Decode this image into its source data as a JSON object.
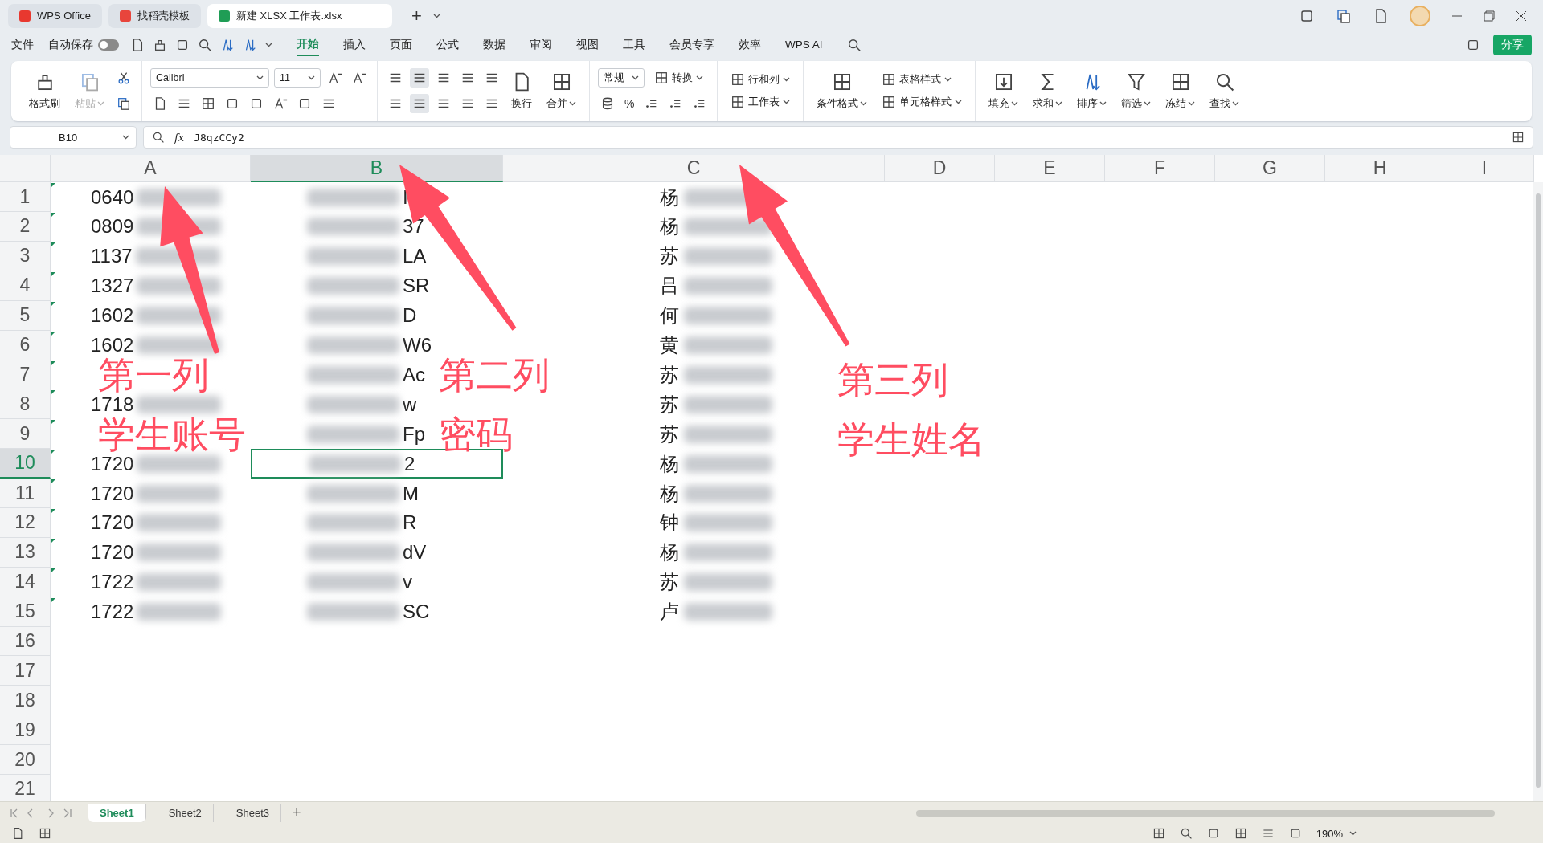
{
  "title_bar": {
    "tabs": [
      {
        "label": "WPS Office",
        "selected": false,
        "color": "#e8382f"
      },
      {
        "label": "找稻壳模板",
        "selected": false,
        "color": "#e8453c"
      },
      {
        "label": "新建 XLSX 工作表.xlsx",
        "selected": true,
        "color": "#1f9d55"
      }
    ],
    "new_tab": "+"
  },
  "menu_bar": {
    "file": "文件",
    "autosave": {
      "label": "自动保存",
      "on": false
    },
    "tabs": [
      {
        "label": "开始",
        "selected": true
      },
      {
        "label": "插入",
        "selected": false
      },
      {
        "label": "页面",
        "selected": false
      },
      {
        "label": "公式",
        "selected": false
      },
      {
        "label": "数据",
        "selected": false
      },
      {
        "label": "审阅",
        "selected": false
      },
      {
        "label": "视图",
        "selected": false
      },
      {
        "label": "工具",
        "selected": false
      },
      {
        "label": "会员专享",
        "selected": false
      },
      {
        "label": "效率",
        "selected": false
      },
      {
        "label": "WPS AI",
        "selected": false
      }
    ],
    "share": "分享"
  },
  "ribbon": {
    "groups": [
      {
        "items": [
          {
            "kind": "large",
            "label": "格式刷",
            "menu": false,
            "disabled": false
          },
          {
            "kind": "large",
            "label": "粘贴",
            "menu": true,
            "disabled": true
          },
          {
            "kind": "stack",
            "rows": [
              [
                {
                  "kind": "icon",
                  "selected": false
                }
              ],
              [
                {
                  "kind": "icon",
                  "selected": false
                }
              ]
            ]
          }
        ]
      },
      {
        "items": [
          {
            "kind": "stack",
            "rows": [
              [
                {
                  "kind": "select",
                  "value": "Calibri",
                  "wide": true
                },
                {
                  "kind": "select",
                  "value": "11",
                  "wide": false
                },
                {
                  "kind": "icon",
                  "selected": false
                },
                {
                  "kind": "icon",
                  "selected": false
                }
              ],
              [
                {
                  "kind": "icon",
                  "selected": false
                },
                {
                  "kind": "icon",
                  "selected": false
                },
                {
                  "kind": "icon",
                  "selected": false
                },
                {
                  "kind": "icon",
                  "selected": false
                },
                {
                  "kind": "icon",
                  "selected": false
                },
                {
                  "kind": "icon",
                  "selected": false
                },
                {
                  "kind": "icon",
                  "selected": false
                },
                {
                  "kind": "icon",
                  "selected": false
                }
              ]
            ]
          }
        ]
      },
      {
        "items": [
          {
            "kind": "stack",
            "rows": [
              [
                {
                  "kind": "icon",
                  "selected": false
                },
                {
                  "kind": "icon",
                  "selected": true
                },
                {
                  "kind": "icon",
                  "selected": false
                },
                {
                  "kind": "icon",
                  "selected": false
                },
                {
                  "kind": "icon",
                  "selected": false
                }
              ],
              [
                {
                  "kind": "icon",
                  "selected": false
                },
                {
                  "kind": "icon",
                  "selected": true
                },
                {
                  "kind": "icon",
                  "selected": false
                },
                {
                  "kind": "icon",
                  "selected": false
                },
                {
                  "kind": "icon",
                  "selected": false
                }
              ]
            ]
          },
          {
            "kind": "large",
            "label": "换行",
            "menu": false,
            "disabled": false
          },
          {
            "kind": "large",
            "label": "合并",
            "menu": true,
            "disabled": false
          }
        ]
      },
      {
        "items": [
          {
            "kind": "stack",
            "rows": [
              [
                {
                  "kind": "select",
                  "value": "常规",
                  "wide": false
                },
                {
                  "kind": "labeled",
                  "label": "转换",
                  "menu": true
                }
              ],
              [
                {
                  "kind": "icon",
                  "selected": false
                },
                {
                  "kind": "text",
                  "label": "%"
                },
                {
                  "kind": "icon",
                  "selected": false
                },
                {
                  "kind": "icon",
                  "selected": false
                },
                {
                  "kind": "icon",
                  "selected": false
                }
              ]
            ]
          }
        ]
      },
      {
        "items": [
          {
            "kind": "stack",
            "rows": [
              [
                {
                  "kind": "labeled",
                  "label": "行和列",
                  "menu": true
                }
              ],
              [
                {
                  "kind": "labeled",
                  "label": "工作表",
                  "menu": true
                }
              ]
            ]
          }
        ]
      },
      {
        "items": [
          {
            "kind": "large",
            "label": "条件格式",
            "menu": true,
            "disabled": false
          },
          {
            "kind": "stack",
            "rows": [
              [
                {
                  "kind": "labeled",
                  "label": "表格样式",
                  "menu": true
                }
              ],
              [
                {
                  "kind": "labeled",
                  "label": "单元格样式",
                  "menu": true
                }
              ]
            ]
          }
        ]
      },
      {
        "items": [
          {
            "kind": "large",
            "label": "填充",
            "menu": true,
            "disabled": false
          },
          {
            "kind": "large",
            "label": "求和",
            "menu": true,
            "disabled": false
          },
          {
            "kind": "large",
            "label": "排序",
            "menu": true,
            "disabled": false
          },
          {
            "kind": "large",
            "label": "筛选",
            "menu": true,
            "disabled": false
          },
          {
            "kind": "large",
            "label": "冻结",
            "menu": true,
            "disabled": false
          },
          {
            "kind": "large",
            "label": "查找",
            "menu": true,
            "disabled": false
          }
        ]
      }
    ]
  },
  "formula_bar": {
    "name_box": "B10",
    "fx": "fx",
    "value": "J8qzCCy2"
  },
  "sheet": {
    "columns": [
      {
        "label": "A",
        "selected": false
      },
      {
        "label": "B",
        "selected": true
      },
      {
        "label": "C",
        "selected": false
      },
      {
        "label": "D",
        "selected": false
      },
      {
        "label": "E",
        "selected": false
      },
      {
        "label": "F",
        "selected": false
      },
      {
        "label": "G",
        "selected": false
      },
      {
        "label": "H",
        "selected": false
      },
      {
        "label": "I",
        "selected": false
      }
    ],
    "rows": [
      {
        "number": "1",
        "selected": false,
        "cells": [
          "0640",
          "I",
          "杨"
        ]
      },
      {
        "number": "2",
        "selected": false,
        "cells": [
          "0809",
          "37",
          "杨"
        ]
      },
      {
        "number": "3",
        "selected": false,
        "cells": [
          "1137",
          "LA",
          "苏"
        ]
      },
      {
        "number": "4",
        "selected": false,
        "cells": [
          "1327",
          "SR",
          "吕"
        ]
      },
      {
        "number": "5",
        "selected": false,
        "cells": [
          "1602",
          "D",
          "何"
        ]
      },
      {
        "number": "6",
        "selected": false,
        "cells": [
          "1602",
          "W6",
          "黄"
        ]
      },
      {
        "number": "7",
        "selected": false,
        "cells": [
          null,
          "Ac",
          "苏"
        ]
      },
      {
        "number": "8",
        "selected": false,
        "cells": [
          "1718",
          "w",
          "苏"
        ]
      },
      {
        "number": "9",
        "selected": false,
        "cells": [
          null,
          "Fp",
          "苏"
        ]
      },
      {
        "number": "10",
        "selected": true,
        "cells": [
          "1720",
          "2",
          "杨"
        ]
      },
      {
        "number": "11",
        "selected": false,
        "cells": [
          "1720",
          "M",
          "杨"
        ]
      },
      {
        "number": "12",
        "selected": false,
        "cells": [
          "1720",
          "R",
          "钟"
        ]
      },
      {
        "number": "13",
        "selected": false,
        "cells": [
          "1720",
          "dV",
          "杨"
        ]
      },
      {
        "number": "14",
        "selected": false,
        "cells": [
          "1722",
          "v",
          "苏"
        ]
      },
      {
        "number": "15",
        "selected": false,
        "cells": [
          "1722",
          "SC",
          "卢"
        ]
      },
      {
        "number": "16",
        "selected": false
      },
      {
        "number": "17",
        "selected": false
      },
      {
        "number": "18",
        "selected": false
      },
      {
        "number": "19",
        "selected": false
      },
      {
        "number": "20",
        "selected": false
      },
      {
        "number": "21",
        "selected": false
      }
    ]
  },
  "annotations": [
    {
      "lines": [
        "第一列",
        "学生账号"
      ]
    },
    {
      "lines": [
        "第二列",
        "密码"
      ]
    },
    {
      "lines": [
        "第三列",
        "学生姓名"
      ]
    }
  ],
  "sheet_tabs": {
    "tabs": [
      {
        "label": "Sheet1",
        "selected": true
      },
      {
        "label": "Sheet2",
        "selected": false
      },
      {
        "label": "Sheet3",
        "selected": false
      }
    ],
    "add": "+"
  },
  "status_bar": {
    "zoom": "190%"
  }
}
